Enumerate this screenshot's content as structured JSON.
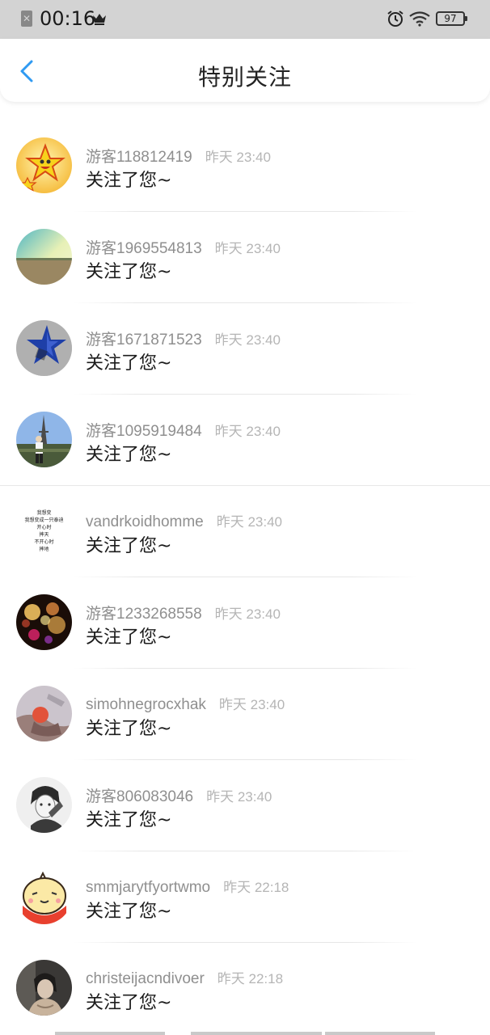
{
  "status_bar": {
    "time": "00:16",
    "battery": "97",
    "icons": [
      "app-close-icon",
      "crown-icon",
      "alarm-icon",
      "wifi-icon",
      "battery-icon"
    ]
  },
  "header": {
    "title": "特别关注",
    "back_icon": "chevron-left-icon",
    "accent": "#2f9af2"
  },
  "items": [
    {
      "username": "游客118812419",
      "time": "昨天 23:40",
      "message": "关注了您~",
      "avatar": "cartoon-star"
    },
    {
      "username": "游客1969554813",
      "time": "昨天 23:40",
      "message": "关注了您~",
      "avatar": "field-landscape"
    },
    {
      "username": "游客1671871523",
      "time": "昨天 23:40",
      "message": "关注了您~",
      "avatar": "blue-star"
    },
    {
      "username": "游客1095919484",
      "time": "昨天 23:40",
      "message": "关注了您~",
      "avatar": "eiffel-tower"
    },
    {
      "username": "vandrkoidhomme",
      "time": "昨天 23:40",
      "message": "关注了您~",
      "avatar": "text-note"
    },
    {
      "username": "游客1233268558",
      "time": "昨天 23:40",
      "message": "关注了您~",
      "avatar": "bokeh-lights"
    },
    {
      "username": "simohnegrocxhak",
      "time": "昨天 23:40",
      "message": "关注了您~",
      "avatar": "hands-photo"
    },
    {
      "username": "游客806083046",
      "time": "昨天 23:40",
      "message": "关注了您~",
      "avatar": "anime-sketch"
    },
    {
      "username": "smmjarytfyortwmo",
      "time": "昨天 22:18",
      "message": "关注了您~",
      "avatar": "cartoon-face"
    },
    {
      "username": "christeijacndivoer",
      "time": "昨天 22:18",
      "message": "关注了您~",
      "avatar": "portrait-photo"
    }
  ],
  "avatar_texts": {
    "text_note": [
      "我想变",
      "我想变成一只泰迪",
      "开心时",
      "摔天",
      "不开心时",
      "摔地"
    ]
  }
}
